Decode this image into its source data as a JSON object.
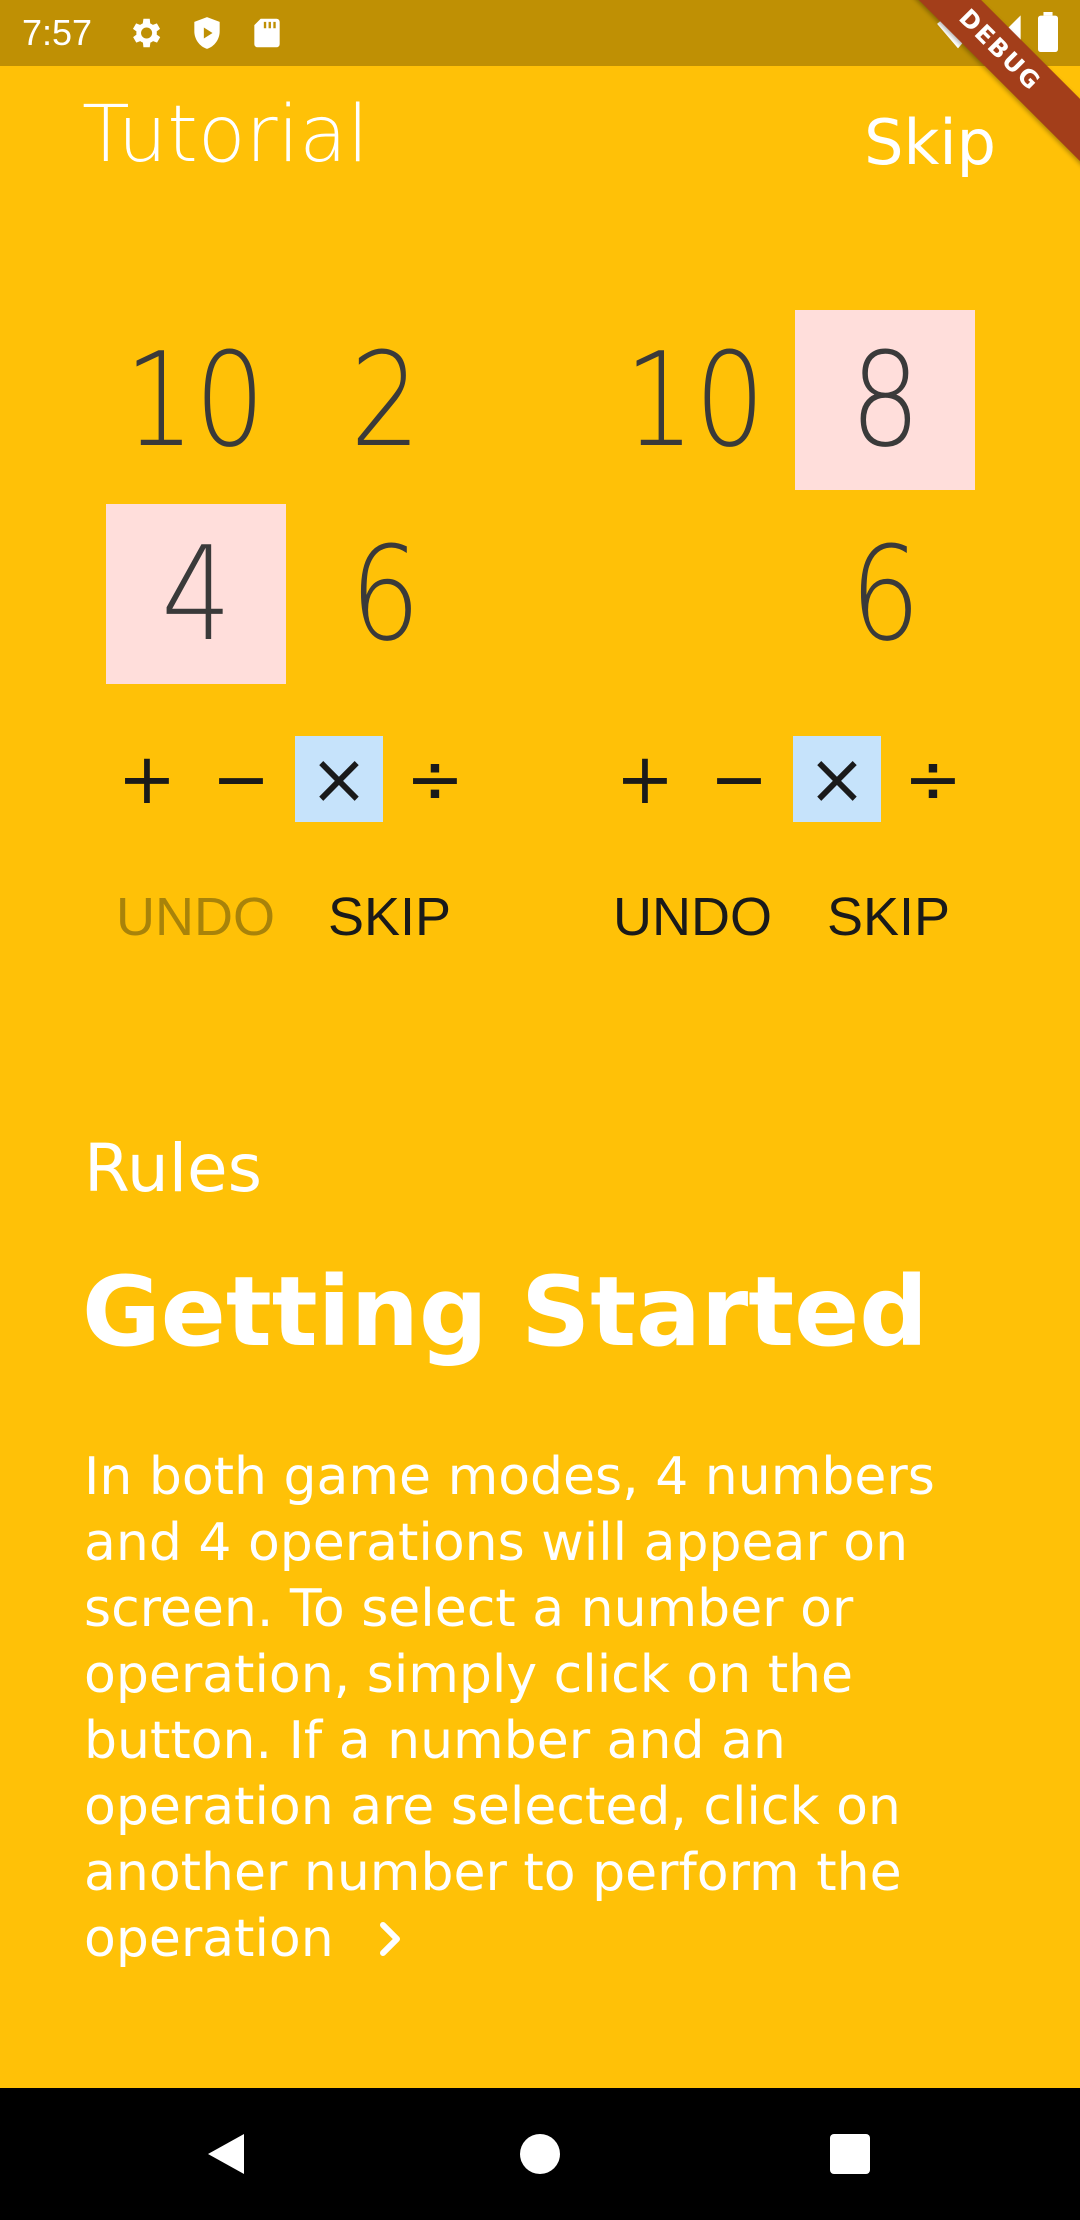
{
  "status_bar": {
    "time": "7:57",
    "icons": [
      "gear-icon",
      "shield-play-icon",
      "sd-card-icon",
      "wifi-icon",
      "cell-signal-icon",
      "battery-icon"
    ],
    "debug_banner": "DEBUG"
  },
  "header": {
    "title": "Tutorial",
    "skip_label": "Skip"
  },
  "demo_left": {
    "numbers": [
      "10",
      "2",
      "4",
      "6"
    ],
    "selected_number": "4",
    "operations": [
      "+",
      "−",
      "×",
      "÷"
    ],
    "selected_operation": "×",
    "undo_label": "UNDO",
    "undo_enabled": false,
    "skip_label": "SKIP"
  },
  "demo_right": {
    "numbers": [
      "10",
      "8",
      "",
      "6"
    ],
    "selected_number": "8",
    "operations": [
      "+",
      "−",
      "×",
      "÷"
    ],
    "selected_operation": "×",
    "undo_label": "UNDO",
    "undo_enabled": true,
    "skip_label": "SKIP"
  },
  "rules": {
    "label": "Rules",
    "heading": "Getting Started",
    "body": "In both game modes, 4 numbers and 4 operations will appear on screen. To select a number or operation, simply click on the button. If a number and an operation are selected, click on another number to perform the operation"
  },
  "colors": {
    "background": "#FFC107",
    "status_bar": "#BF9004",
    "selected_number": "#FFDEDB",
    "selected_operation": "#C6E3FB",
    "disabled_text": "#A8830A"
  },
  "nav_bar": {
    "icons": [
      "back-icon",
      "home-icon",
      "recents-icon"
    ]
  }
}
